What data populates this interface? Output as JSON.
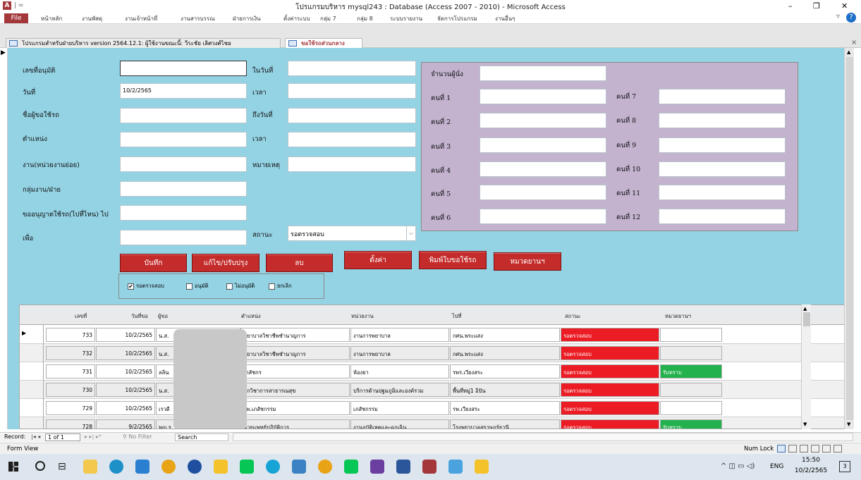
{
  "window": {
    "title": "โปรแกรมบริหาร mysql243 : Database (Access 2007 - 2010) - Microsoft Access",
    "qat": "A | =",
    "controls": [
      "–",
      "❐",
      "✕"
    ]
  },
  "ribbon": {
    "file_label": "File",
    "menu": [
      "หน้าหลัก",
      "งานพัสดุ",
      "งานเจ้าหน้าที่",
      "งานสารบรรณ",
      "ฝ่ายการเงิน",
      "ตั้งค่าระบบ",
      "กลุ่ม 7",
      "กลุ่ม 8",
      "ระบบรายงาน",
      "จัดการโปรแกรม",
      "งานอื่นๆ"
    ]
  },
  "doc_tabs": [
    {
      "label": "โปรแกรมสำหรับฝ่ายบริหาร version 2564.12.1: ผู้ใช้งานขณะนี้: วีระชัย เลิศวงศ์ไชย",
      "active": false
    },
    {
      "label": "ขอใช้รถส่วนกลาง",
      "active": true
    }
  ],
  "form": {
    "left_fields": [
      {
        "label": "เลขที่อนุมัติ",
        "value": ""
      },
      {
        "label": "วันที่",
        "value": "10/2/2565"
      },
      {
        "label": "ชื่อผู้ขอใช้รถ",
        "value": ""
      },
      {
        "label": "ตำแหน่ง",
        "value": ""
      },
      {
        "label": "งาน(หน่วยงานย่อย)",
        "value": ""
      },
      {
        "label": "กลุ่มงาน/ฝ่าย",
        "value": ""
      },
      {
        "label": "ขออนุญาตใช้รถ(ไปที่ไหน) ไป",
        "value": ""
      },
      {
        "label": "เพื่อ",
        "value": ""
      }
    ],
    "mid_fields": [
      {
        "label": "ในวันที่",
        "value": ""
      },
      {
        "label": "เวลา",
        "value": ""
      },
      {
        "label": "ถึงวันที่",
        "value": ""
      },
      {
        "label": "เวลา",
        "value": ""
      },
      {
        "label": "หมายเหตุ",
        "value": ""
      }
    ],
    "status_label": "สถานะ",
    "status_value": "รอตรวจสอบ",
    "passenger_count_label": "จำนวนผู้นั่ง",
    "passengers_left": [
      "คนที่ 1",
      "คนที่ 2",
      "คนที่ 3",
      "คนที่ 4",
      "คนที่ 5",
      "คนที่ 6"
    ],
    "passengers_right": [
      "คนที่ 7",
      "คนที่ 8",
      "คนที่ 9",
      "คนที่ 10",
      "คนที่ 11",
      "คนที่ 12"
    ],
    "buttons": [
      "บันทึก",
      "แก้ไข/ปรับปรุง",
      "ลบ",
      "ตั้งค่า",
      "พิมพ์ใบขอใช้รถ",
      "หมวดยานฯ"
    ],
    "filters": [
      {
        "label": "รอตรวจสอบ",
        "checked": true
      },
      {
        "label": "อนุมัติ",
        "checked": false
      },
      {
        "label": "ไม่อนุมัติ",
        "checked": false
      },
      {
        "label": "ยกเลิก",
        "checked": false
      }
    ]
  },
  "grid": {
    "headers": [
      "เลขที่",
      "วันที่ขอ",
      "ผู้ขอ",
      "ตำแหน่ง",
      "หน่วยงาน",
      "ไปที่",
      "สถานะ",
      "หมวดยานฯ"
    ],
    "rows": [
      {
        "no": "733",
        "date": "10/2/2565",
        "req": "น.ส.",
        "pos": "พยาบาลวิชาชีพชำนาญการ",
        "unit": "งานการพยาบาล",
        "dest": "กศน.พระแสง",
        "status": "รอตรวจสอบ",
        "fleet": ""
      },
      {
        "no": "732",
        "date": "10/2/2565",
        "req": "น.ส.",
        "pos": "พยาบาลวิชาชีพชำนาญการ",
        "unit": "งานการพยาบาล",
        "dest": "กศน.พระแสง",
        "status": "รอตรวจสอบ",
        "fleet": ""
      },
      {
        "no": "731",
        "date": "10/2/2565",
        "req": "ลลิน",
        "pos": "เภสัชกร",
        "unit": "ห้องยา",
        "dest": "รพร.เวียงสระ",
        "status": "รอตรวจสอบ",
        "fleet": "รับทราบ"
      },
      {
        "no": "730",
        "date": "10/2/2565",
        "req": "น.ส.",
        "pos": "นักวิชาการสาธารณสุข",
        "unit": "บริการด้านปฐมภูมิและองค์รวม",
        "dest": "พื้นที่หมู่1 อิปัน",
        "status": "รอตรวจสอบ",
        "fleet": ""
      },
      {
        "no": "729",
        "date": "10/2/2565",
        "req": "เรวดี",
        "pos": "จพ.เภสัชกรรม",
        "unit": "เภสัชกรรม",
        "dest": "รพ.เวียงสระ",
        "status": "รอตรวจสอบ",
        "fleet": ""
      },
      {
        "no": "728",
        "date": "9/2/2565",
        "req": "พญ.รู",
        "pos": "นายแพทย์ปฏิบัติการ",
        "unit": "งานอุบัติเหตุและฉุกเฉิน",
        "dest": "โรงพยาบาลสุราษฎร์ธานี",
        "status": "รอตรวจสอบ",
        "fleet": "รับทราบ"
      }
    ]
  },
  "recnav": {
    "record_label": "Record:",
    "position": "1 of 1",
    "filter": "No Filter",
    "search": "Search"
  },
  "status": {
    "left": "Form View",
    "numlock": "Num Lock"
  },
  "taskbar": {
    "lang": "ENG",
    "time": "15:50",
    "date": "10/2/2565",
    "notif": "3"
  },
  "colors": {
    "form_bg": "#94d3e4",
    "passenger_panel": "#c3b3cf",
    "button_red": "#c42b2b",
    "status_red": "#ec1c24",
    "fleet_green": "#22b14c",
    "access_brand": "#a4373a"
  }
}
